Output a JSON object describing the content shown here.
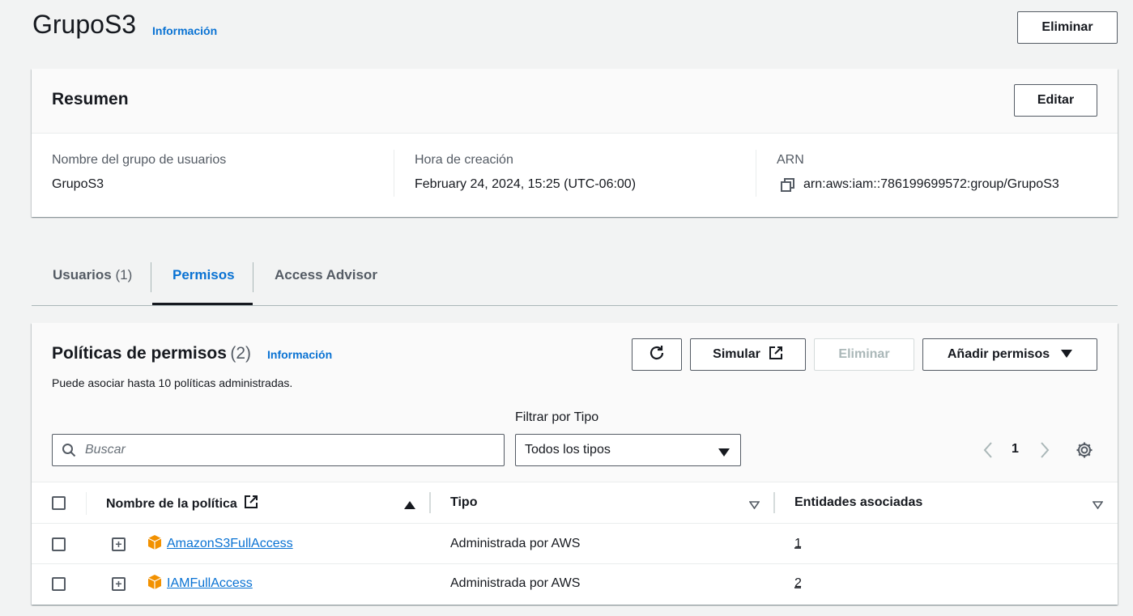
{
  "header": {
    "title": "GrupoS3",
    "info_link": "Información",
    "delete_button": "Eliminar"
  },
  "summary": {
    "title": "Resumen",
    "edit_button": "Editar",
    "fields": [
      {
        "label": "Nombre del grupo de usuarios",
        "value": "GrupoS3"
      },
      {
        "label": "Hora de creación",
        "value": "February 24, 2024, 15:25 (UTC-06:00)"
      },
      {
        "label": "ARN",
        "value": "arn:aws:iam::786199699572:group/GrupoS3"
      }
    ]
  },
  "tabs": [
    {
      "label": "Usuarios",
      "count": "(1)"
    },
    {
      "label": "Permisos"
    },
    {
      "label": "Access Advisor"
    }
  ],
  "policies": {
    "title": "Políticas de permisos",
    "count": "(2)",
    "info_link": "Información",
    "description": "Puede asociar hasta 10 políticas administradas.",
    "buttons": {
      "simulate": "Simular",
      "delete": "Eliminar",
      "add": "Añadir permisos"
    },
    "search_placeholder": "Buscar",
    "filter_label": "Filtrar por Tipo",
    "filter_value": "Todos los tipos",
    "page_number": "1",
    "columns": [
      "Nombre de la política",
      "Tipo",
      "Entidades asociadas"
    ],
    "rows": [
      {
        "name": "AmazonS3FullAccess",
        "type": "Administrada por AWS",
        "entities": "1"
      },
      {
        "name": "IAMFullAccess",
        "type": "Administrada por AWS",
        "entities": "2"
      }
    ]
  },
  "colors": {
    "accent": "#0972d3",
    "background": "#f2f3f3",
    "policy_icon": "#f29100"
  }
}
